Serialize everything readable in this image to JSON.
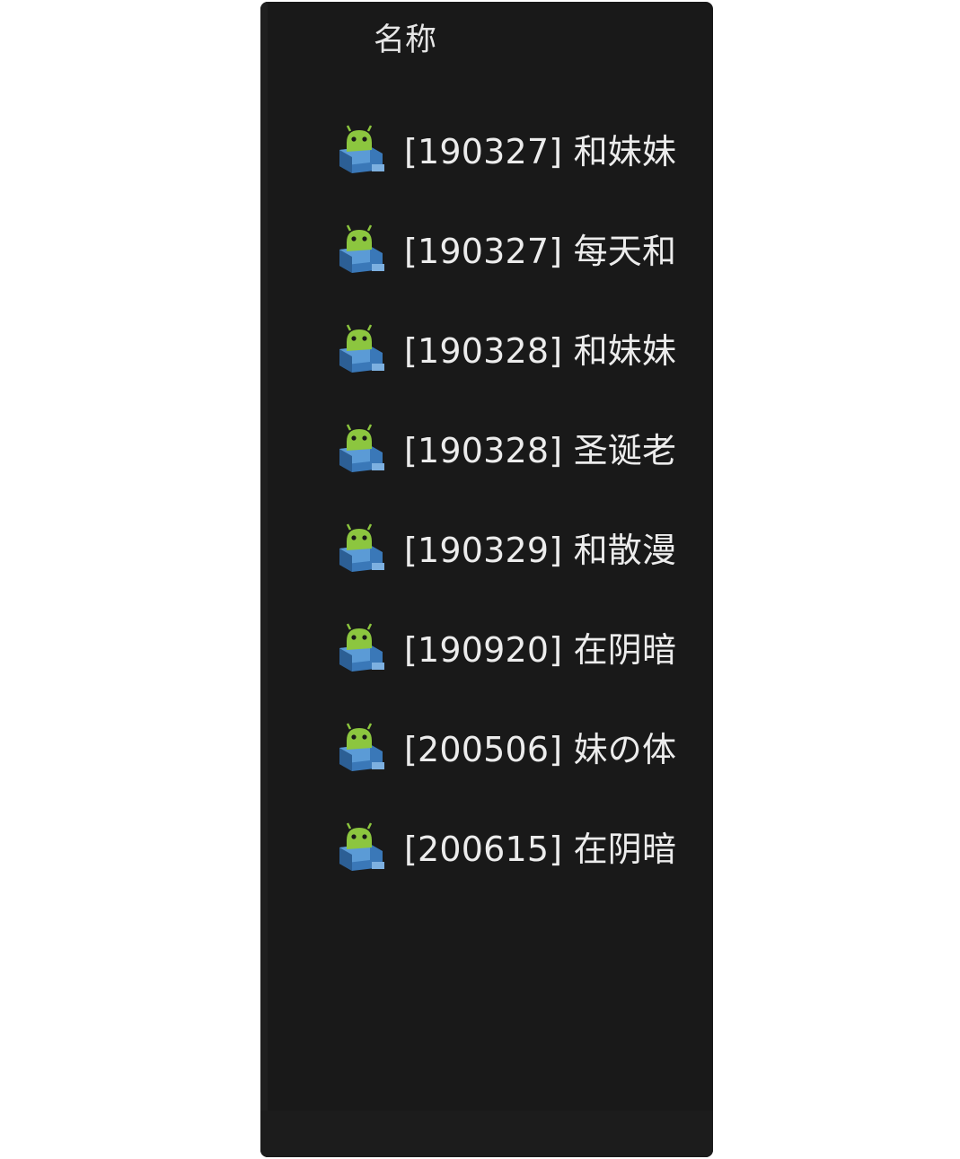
{
  "column_header": "名称",
  "files": [
    {
      "name": "[190327] 和妹妹",
      "icon": "android-apk-icon"
    },
    {
      "name": "[190327] 每天和",
      "icon": "android-apk-icon"
    },
    {
      "name": "[190328] 和妹妹",
      "icon": "android-apk-icon"
    },
    {
      "name": "[190328] 圣诞老",
      "icon": "android-apk-icon"
    },
    {
      "name": "[190329] 和散漫",
      "icon": "android-apk-icon"
    },
    {
      "name": "[190920] 在阴暗",
      "icon": "android-apk-icon"
    },
    {
      "name": "[200506] 妹の体",
      "icon": "android-apk-icon"
    },
    {
      "name": "[200615] 在阴暗",
      "icon": "android-apk-icon"
    }
  ],
  "colors": {
    "panel_background": "#191919",
    "text": "#ececec",
    "icon_green": "#8cc63f",
    "icon_blue": "#3a78b8"
  }
}
